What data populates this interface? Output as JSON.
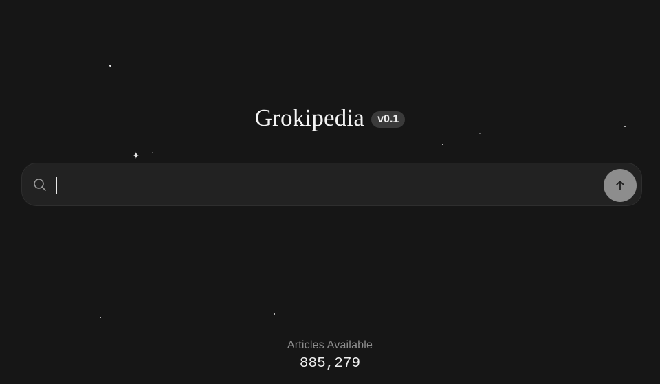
{
  "brand": {
    "title": "Grokipedia",
    "version": "v0.1"
  },
  "search": {
    "value": "",
    "placeholder": "",
    "icon": "search-icon",
    "submit_icon": "arrow-up-icon"
  },
  "stats": {
    "label": "Articles Available",
    "value": "885,279"
  },
  "colors": {
    "background": "#161616",
    "search_bar": "#222222",
    "badge": "#3a3a3a",
    "submit_button": "#8d8d8d"
  }
}
